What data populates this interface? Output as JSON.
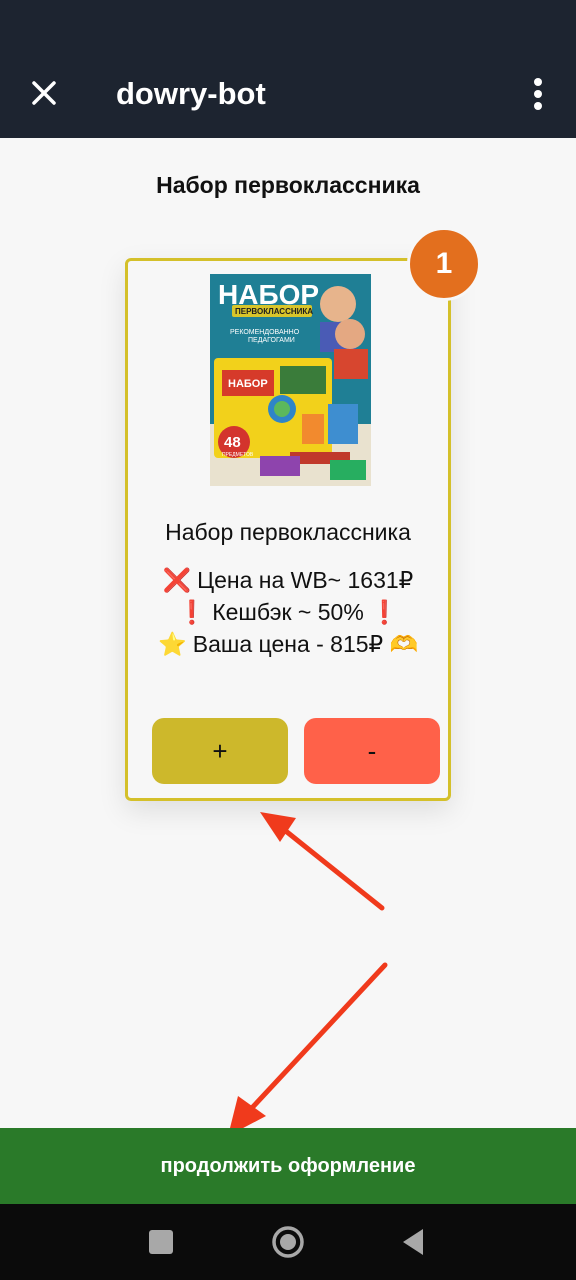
{
  "app_bar": {
    "title": "dowry-bot",
    "close_icon": "close-icon",
    "menu_icon": "more-vertical-icon"
  },
  "page": {
    "title": "Набор первоклассника"
  },
  "card": {
    "badge": "1",
    "image": {
      "heading": "НАБОР",
      "subheading": "ПЕРВОКЛАССНИКА",
      "tagline_line1": "РЕКОМЕНДОВАННО",
      "tagline_line2": "ПЕДАГОГАМИ",
      "box_label": "НАБОР",
      "count": "48",
      "count_label": "ПРЕДМЕТОВ"
    },
    "name": "Набор первоклассника",
    "lines": [
      {
        "emoji": "❌",
        "text": "Цена на WB~ 1631₽",
        "suffix": ""
      },
      {
        "emoji": "❗",
        "text": "Кешбэк ~ 50%",
        "suffix": "❗"
      },
      {
        "emoji": "⭐",
        "text": "Ваша цена - 815₽",
        "suffix": "🫶"
      }
    ],
    "plus_label": "+",
    "minus_label": "-"
  },
  "checkout": {
    "label": "продолжить оформление"
  },
  "nav": {
    "icons": [
      "square-icon",
      "home-circle-icon",
      "back-triangle-icon"
    ]
  },
  "colors": {
    "app_bar": "#1d2430",
    "card_border": "#d4c02a",
    "badge": "#e36f1e",
    "plus_button": "#cdb82b",
    "minus_button": "#ff6149",
    "checkout": "#2a7a29",
    "arrow": "#f03a1c"
  }
}
